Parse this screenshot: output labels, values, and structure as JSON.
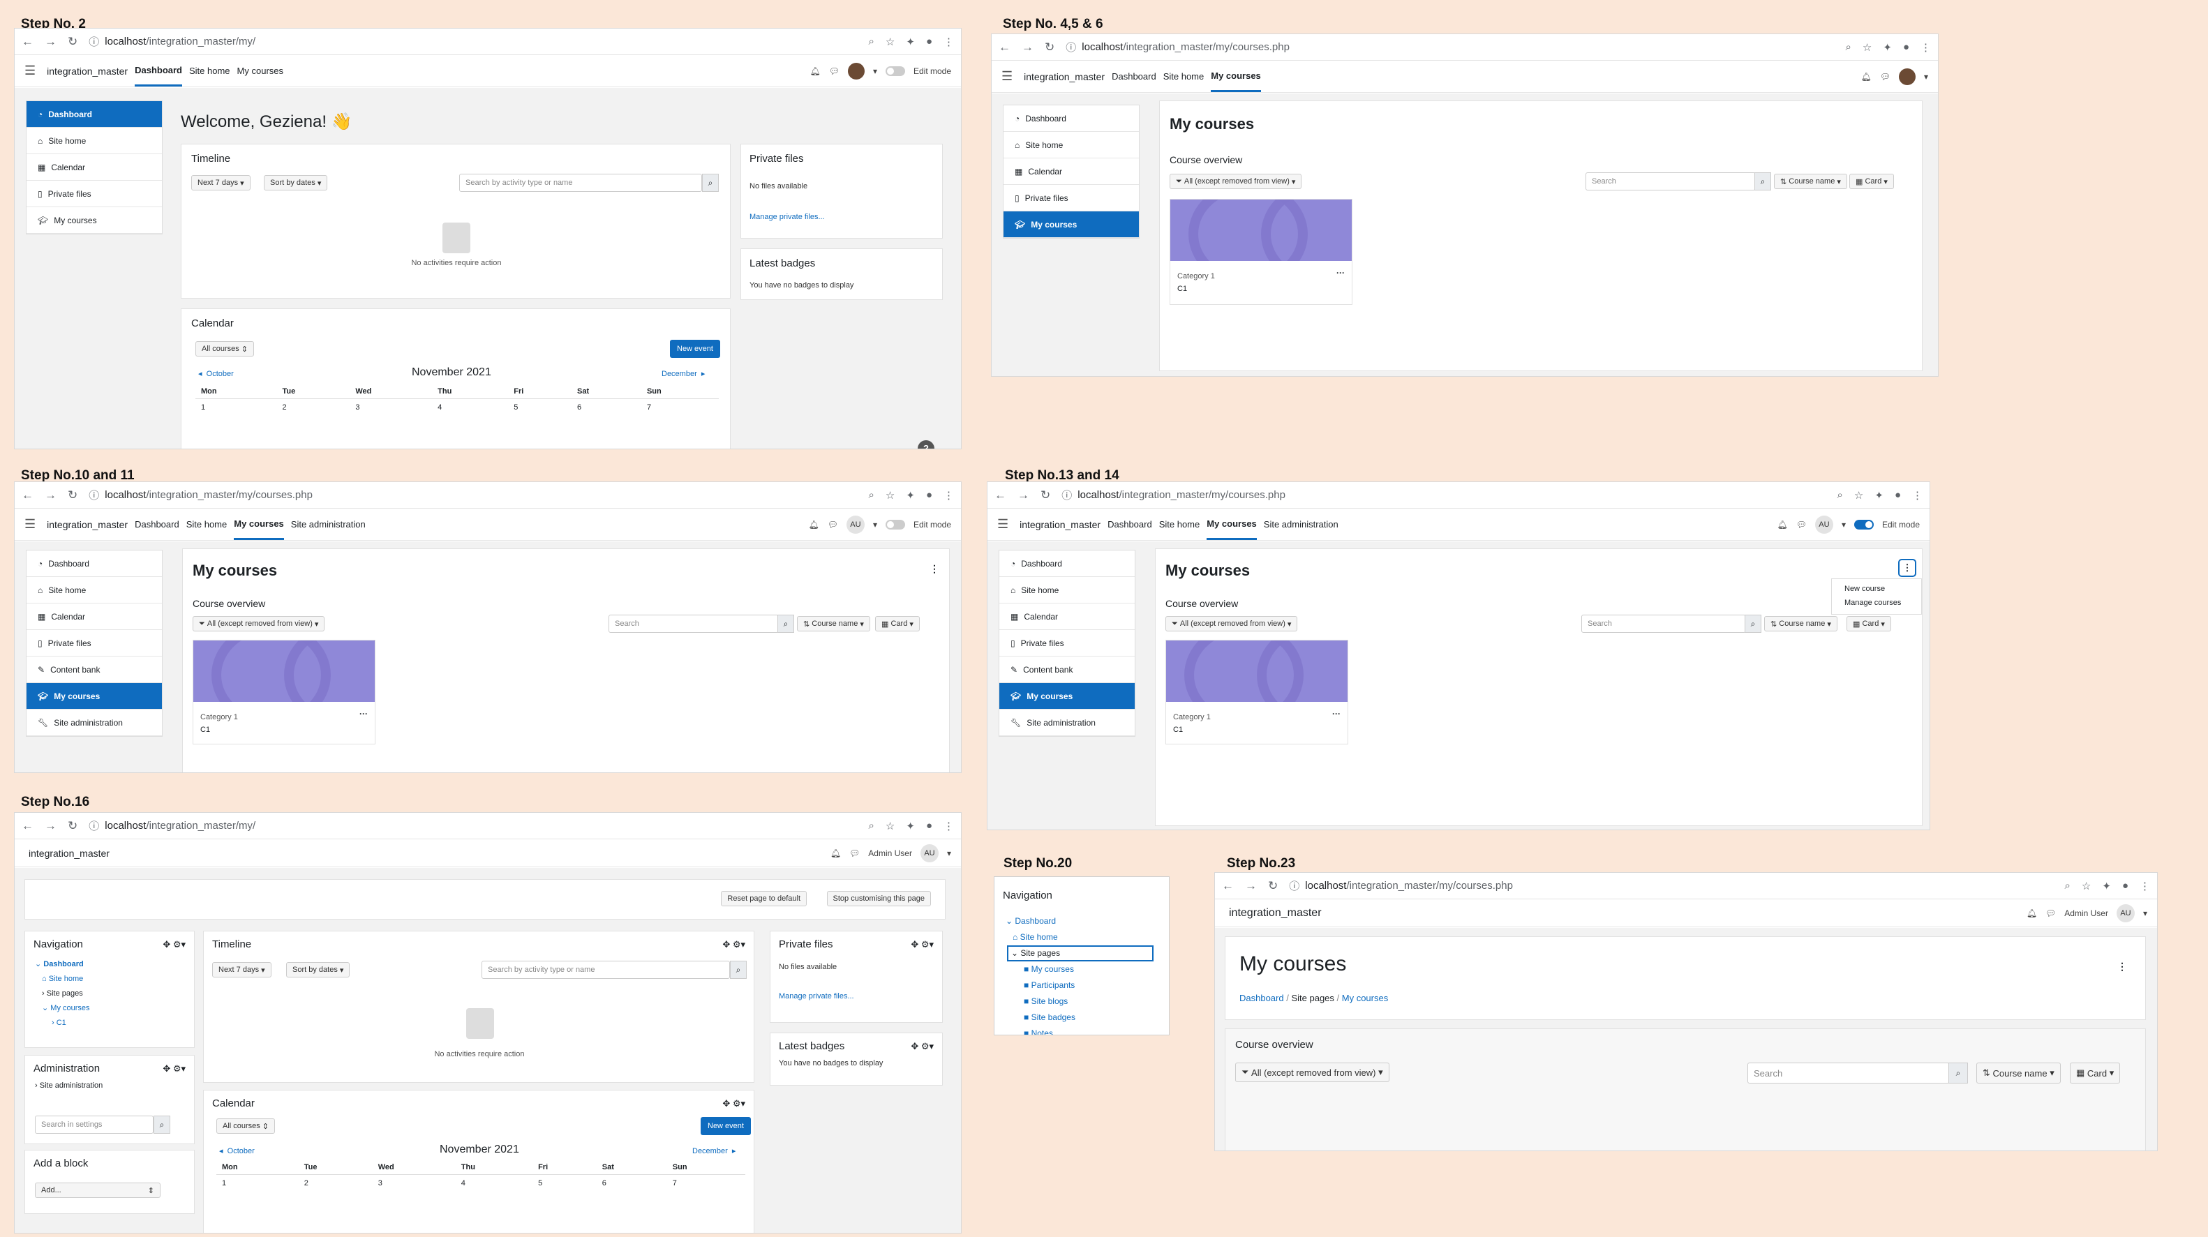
{
  "steps": {
    "s2": "Step No. 2",
    "s4": "Step No. 4,5 & 6",
    "s10": "Step No.10 and 11",
    "s13": "Step No.13 and 14",
    "s16": "Step No.16",
    "s20": "Step No.20",
    "s23": "Step No.23"
  },
  "url_host": "localhost",
  "url_my": "/integration_master/my/",
  "url_courses": "/integration_master/my/courses.php",
  "site": "integration_master",
  "nav": {
    "dashboard": "Dashboard",
    "sitehome": "Site home",
    "mycourses": "My courses",
    "siteadmin": "Site administration",
    "editmode": "Edit mode",
    "au": "AU",
    "adminuser": "Admin User"
  },
  "drawer": {
    "dashboard": "Dashboard",
    "sitehome": "Site home",
    "calendar": "Calendar",
    "privatefiles": "Private files",
    "mycourses": "My courses",
    "contentbank": "Content bank",
    "siteadmin": "Site administration"
  },
  "dash": {
    "welcome": "Welcome, Geziena! 👋",
    "timeline": "Timeline",
    "next7": "Next 7 days",
    "sortdates": "Sort by dates",
    "searchact": "Search by activity type or name",
    "noact": "No activities require action",
    "privatefiles": "Private files",
    "nofiles": "No files available",
    "manage": "Manage private files...",
    "badges": "Latest badges",
    "nobadges": "You have no badges to display",
    "calendar": "Calendar",
    "allcourses": "All courses",
    "newevent": "New event",
    "october": "October",
    "december": "December",
    "month": "November 2021",
    "days": [
      "Mon",
      "Tue",
      "Wed",
      "Thu",
      "Fri",
      "Sat",
      "Sun"
    ],
    "dates": [
      "1",
      "2",
      "3",
      "4",
      "5",
      "6",
      "7"
    ],
    "help": "?"
  },
  "courses": {
    "title": "My courses",
    "overview": "Course overview",
    "filter": "All (except removed from view)",
    "search": "Search",
    "coursename": "Course name",
    "card": "Card",
    "category": "Category 1",
    "c1": "C1",
    "more": "···",
    "newcourse": "New course",
    "managecourses": "Manage courses"
  },
  "s16": {
    "reset": "Reset page to default",
    "stop": "Stop customising this page",
    "navigation": "Navigation",
    "dashboard": "Dashboard",
    "sitehome": "Site home",
    "sitepages": "Site pages",
    "mycourses": "My courses",
    "c1": "C1",
    "administration": "Administration",
    "siteadmin": "Site administration",
    "searchsettings": "Search in settings",
    "addblock": "Add a block",
    "add": "Add..."
  },
  "s20": {
    "navigation": "Navigation",
    "dashboard": "Dashboard",
    "sitehome": "Site home",
    "sitepages": "Site pages",
    "mycourses": "My courses",
    "participants": "Participants",
    "siteblogs": "Site blogs",
    "sitebadges": "Site badges",
    "notes": "Notes"
  },
  "s23": {
    "crumb_dash": "Dashboard",
    "crumb_pages": "Site pages",
    "crumb_courses": "My courses"
  }
}
